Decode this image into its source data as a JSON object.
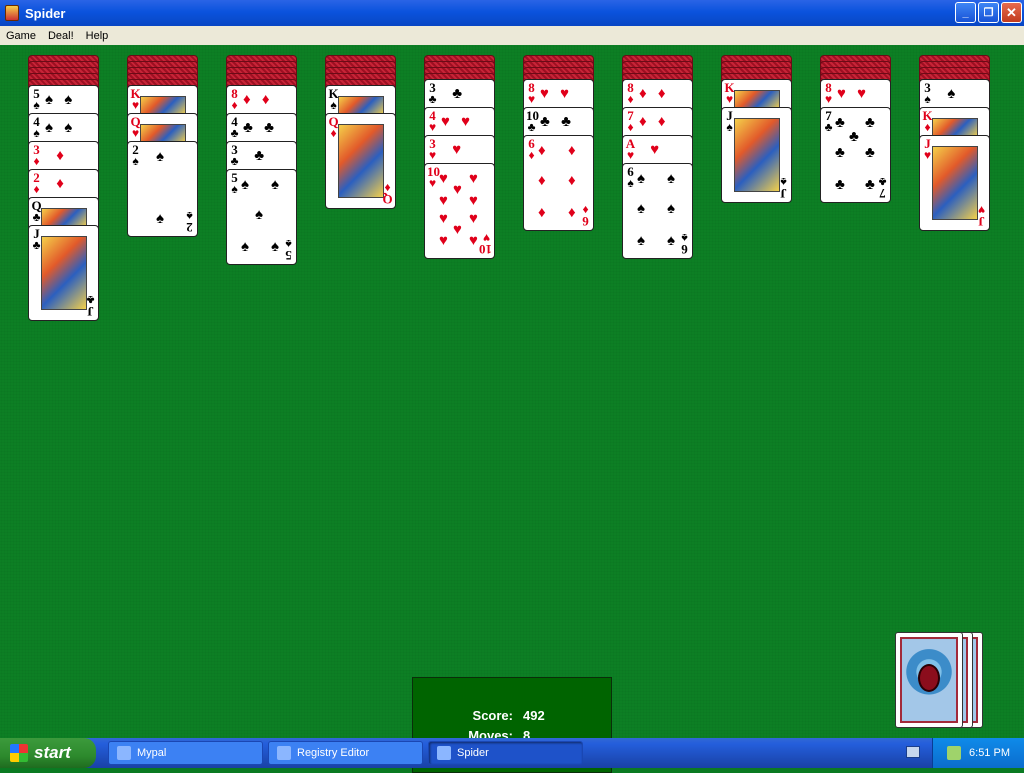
{
  "window": {
    "title": "Spider",
    "minimize_label": "_",
    "maximize_label": "❐",
    "close_label": "✕"
  },
  "menu": [
    "Game",
    "Deal!",
    "Help"
  ],
  "tableau": [
    {
      "backs": 5,
      "cards": [
        {
          "rank": "5",
          "suit": "♠"
        },
        {
          "rank": "4",
          "suit": "♠"
        },
        {
          "rank": "3",
          "suit": "♦"
        },
        {
          "rank": "2",
          "suit": "♦"
        },
        {
          "rank": "Q",
          "suit": "♣"
        },
        {
          "rank": "J",
          "suit": "♣"
        }
      ]
    },
    {
      "backs": 5,
      "cards": [
        {
          "rank": "K",
          "suit": "♥"
        },
        {
          "rank": "Q",
          "suit": "♥"
        },
        {
          "rank": "2",
          "suit": "♠"
        }
      ]
    },
    {
      "backs": 5,
      "cards": [
        {
          "rank": "8",
          "suit": "♦"
        },
        {
          "rank": "4",
          "suit": "♣"
        },
        {
          "rank": "3",
          "suit": "♣"
        },
        {
          "rank": "5",
          "suit": "♠"
        }
      ]
    },
    {
      "backs": 5,
      "cards": [
        {
          "rank": "K",
          "suit": "♠"
        },
        {
          "rank": "Q",
          "suit": "♦"
        }
      ]
    },
    {
      "backs": 4,
      "cards": [
        {
          "rank": "3",
          "suit": "♣"
        },
        {
          "rank": "4",
          "suit": "♥"
        },
        {
          "rank": "3",
          "suit": "♥"
        },
        {
          "rank": "10",
          "suit": "♥"
        }
      ]
    },
    {
      "backs": 4,
      "cards": [
        {
          "rank": "8",
          "suit": "♥"
        },
        {
          "rank": "10",
          "suit": "♣"
        },
        {
          "rank": "6",
          "suit": "♦"
        }
      ]
    },
    {
      "backs": 4,
      "cards": [
        {
          "rank": "8",
          "suit": "♦"
        },
        {
          "rank": "7",
          "suit": "♦"
        },
        {
          "rank": "A",
          "suit": "♥"
        },
        {
          "rank": "6",
          "suit": "♠"
        }
      ]
    },
    {
      "backs": 4,
      "cards": [
        {
          "rank": "K",
          "suit": "♥"
        },
        {
          "rank": "J",
          "suit": "♠"
        }
      ]
    },
    {
      "backs": 4,
      "cards": [
        {
          "rank": "8",
          "suit": "♥"
        },
        {
          "rank": "7",
          "suit": "♣"
        }
      ]
    },
    {
      "backs": 4,
      "cards": [
        {
          "rank": "3",
          "suit": "♠"
        },
        {
          "rank": "K",
          "suit": "♦"
        },
        {
          "rank": "J",
          "suit": "♥"
        }
      ]
    }
  ],
  "score": {
    "score_label": "Score:",
    "score_value": "492",
    "moves_label": "Moves:",
    "moves_value": "8"
  },
  "stock": {
    "piles_remaining": 3
  },
  "taskbar": {
    "start_label": "start",
    "tasks": [
      {
        "label": "Mypal",
        "active": false
      },
      {
        "label": "Registry Editor",
        "active": false
      },
      {
        "label": "Spider",
        "active": true
      }
    ],
    "clock": "6:51 PM"
  }
}
